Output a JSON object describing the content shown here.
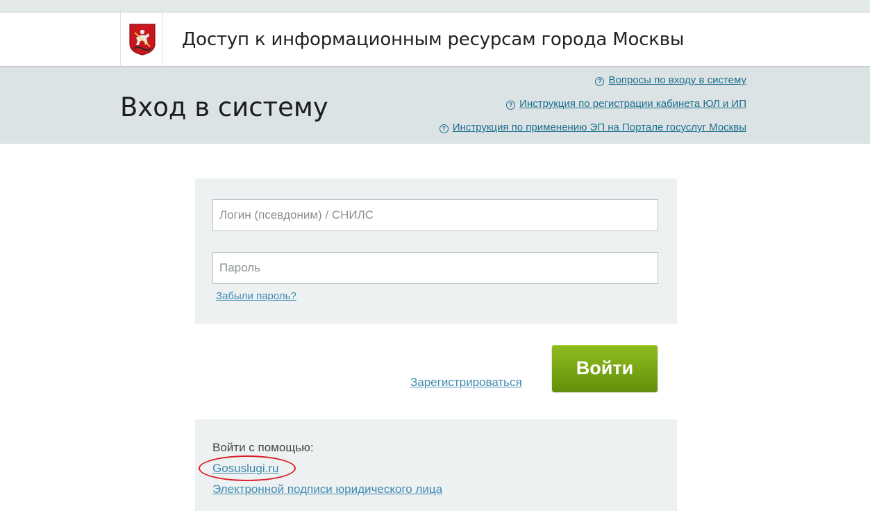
{
  "header": {
    "title": "Доступ к информационным ресурсам города Москвы",
    "logo_icon": "moscow-coat-of-arms-icon"
  },
  "login_band": {
    "title": "Вход в систему",
    "help_links": [
      {
        "label": "Вопросы по входу в систему",
        "icon": "question-circle-icon"
      },
      {
        "label": "Инструкция по регистрации кабинета ЮЛ и ИП",
        "icon": "question-circle-icon"
      },
      {
        "label": "Инструкция по применению ЭП на Портале госуслуг Москвы",
        "icon": "question-circle-icon"
      }
    ]
  },
  "form": {
    "login_placeholder": "Логин (псевдоним) / СНИЛС",
    "login_value": "",
    "password_placeholder": "Пароль",
    "password_value": "",
    "forgot_label": "Забыли пароль?"
  },
  "actions": {
    "register_label": "Зарегистрироваться",
    "login_button_label": "Войти"
  },
  "alt_login": {
    "title": "Войти с помощью:",
    "gosuslugi_label": "Gosuslugi.ru",
    "ep_label": "Электронной подписи юридического лица"
  },
  "colors": {
    "band_bg": "#dce3e5",
    "panel_bg": "#eef1f2",
    "link": "#3d8bb0",
    "help_link": "#1b6f8c",
    "button_green": "#7aaa14",
    "annotation_red": "#d81e28"
  }
}
